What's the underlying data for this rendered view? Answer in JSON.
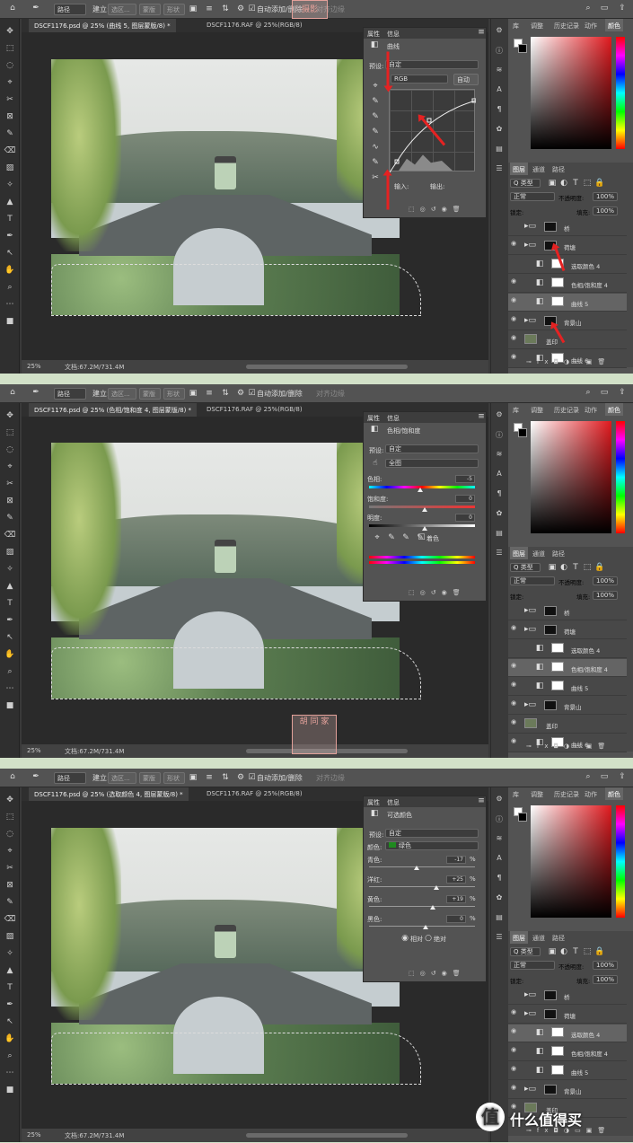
{
  "options": {
    "path_mode": "路径",
    "build_label": "建立:",
    "selection_btn": "选区...",
    "mask_btn": "蒙版",
    "shape_btn": "形状",
    "auto_add_delete": "自动添加/删除",
    "align_edges": "对齐边缘"
  },
  "panels": {
    "library": "库",
    "adjustments": "调整",
    "history": "历史记录",
    "actions": "动作",
    "color": "颜色",
    "layers": "图层",
    "channels": "通道",
    "paths": "路径",
    "kind": "Q 类型",
    "blend": "正常",
    "opacity_label": "不透明度:",
    "opacity": "100%",
    "lock_label": "锁定:",
    "fill_label": "填充:",
    "fill": "100%",
    "properties": "属性",
    "info": "信息"
  },
  "screens": [
    {
      "doc_tab": "DSCF1176.psd @ 25% (曲线 5, 图层蒙版/8) *",
      "raw_tab": "DSCF1176.RAF @ 25%(RGB/8)",
      "zoom": "25%",
      "doc_info": "文档:67.2M/731.4M",
      "panel": "curves",
      "panel_title": "曲线",
      "preset_label": "预设:",
      "preset": "自定",
      "channel": "RGB",
      "auto": "自动",
      "input_label": "输入:",
      "output_label": "输出:",
      "layers": [
        {
          "name": "桥",
          "type": "group",
          "eye": false
        },
        {
          "name": "荷塘",
          "type": "group",
          "eye": true
        },
        {
          "name": "选取颜色 4",
          "type": "adj",
          "eye": false
        },
        {
          "name": "色相/饱和度 4",
          "type": "adj",
          "eye": true
        },
        {
          "name": "曲线 5",
          "type": "adj",
          "eye": true,
          "active": true
        },
        {
          "name": "背景山",
          "type": "group",
          "eye": true
        },
        {
          "name": "盖印",
          "type": "pix",
          "eye": true
        },
        {
          "name": "曲线 6",
          "type": "adj",
          "eye": true
        }
      ],
      "seal": "摄影"
    },
    {
      "doc_tab": "DSCF1176.psd @ 25% (色相/饱和度 4, 图层蒙版/8) *",
      "raw_tab": "DSCF1176.RAF @ 25%(RGB/8)",
      "zoom": "25%",
      "doc_info": "文档:67.2M/731.4M",
      "panel": "huesat",
      "panel_title": "色相/饱和度",
      "preset_label": "预设:",
      "preset": "自定",
      "channel": "全图",
      "hue_label": "色相:",
      "hue": "-5",
      "sat_label": "饱和度:",
      "sat": "0",
      "light_label": "明度:",
      "light": "0",
      "colorize": "着色",
      "layers": [
        {
          "name": "桥",
          "type": "group",
          "eye": false
        },
        {
          "name": "荷塘",
          "type": "group",
          "eye": true
        },
        {
          "name": "选取颜色 4",
          "type": "adj",
          "eye": false
        },
        {
          "name": "色相/饱和度 4",
          "type": "adj",
          "eye": true,
          "active": true
        },
        {
          "name": "曲线 5",
          "type": "adj",
          "eye": true
        },
        {
          "name": "背景山",
          "type": "group",
          "eye": true
        },
        {
          "name": "盖印",
          "type": "pix",
          "eye": true
        },
        {
          "name": "曲线 6",
          "type": "adj",
          "eye": true
        }
      ],
      "seal": "胡 同 家"
    },
    {
      "doc_tab": "DSCF1176.psd @ 25% (选取颜色 4, 图层蒙版/8) *",
      "raw_tab": "DSCF1176.RAF @ 25%(RGB/8)",
      "zoom": "25%",
      "doc_info": "文档:67.2M/731.4M",
      "panel": "selcolor",
      "panel_title": "可选颜色",
      "preset_label": "预设:",
      "preset": "自定",
      "colors_label": "颜色:",
      "colors": "绿色",
      "cyan_label": "青色:",
      "cyan": "-17",
      "magenta_label": "洋红:",
      "magenta": "+25",
      "yellow_label": "黄色:",
      "yellow": "+19",
      "black_label": "黑色:",
      "black": "0",
      "pct": "%",
      "relative": "相对",
      "absolute": "绝对",
      "layers": [
        {
          "name": "桥",
          "type": "group",
          "eye": false
        },
        {
          "name": "荷塘",
          "type": "group",
          "eye": true
        },
        {
          "name": "选取颜色 4",
          "type": "adj",
          "eye": true,
          "active": true
        },
        {
          "name": "色相/饱和度 4",
          "type": "adj",
          "eye": true
        },
        {
          "name": "曲线 5",
          "type": "adj",
          "eye": true
        },
        {
          "name": "背景山",
          "type": "group",
          "eye": true
        },
        {
          "name": "盖印",
          "type": "pix",
          "eye": true
        }
      ],
      "seal": ""
    }
  ],
  "watermark": "什么值得买",
  "watermark_icon": "值",
  "colors": {
    "arrow": "#e52222",
    "accent_green": "#1f8a1f"
  }
}
